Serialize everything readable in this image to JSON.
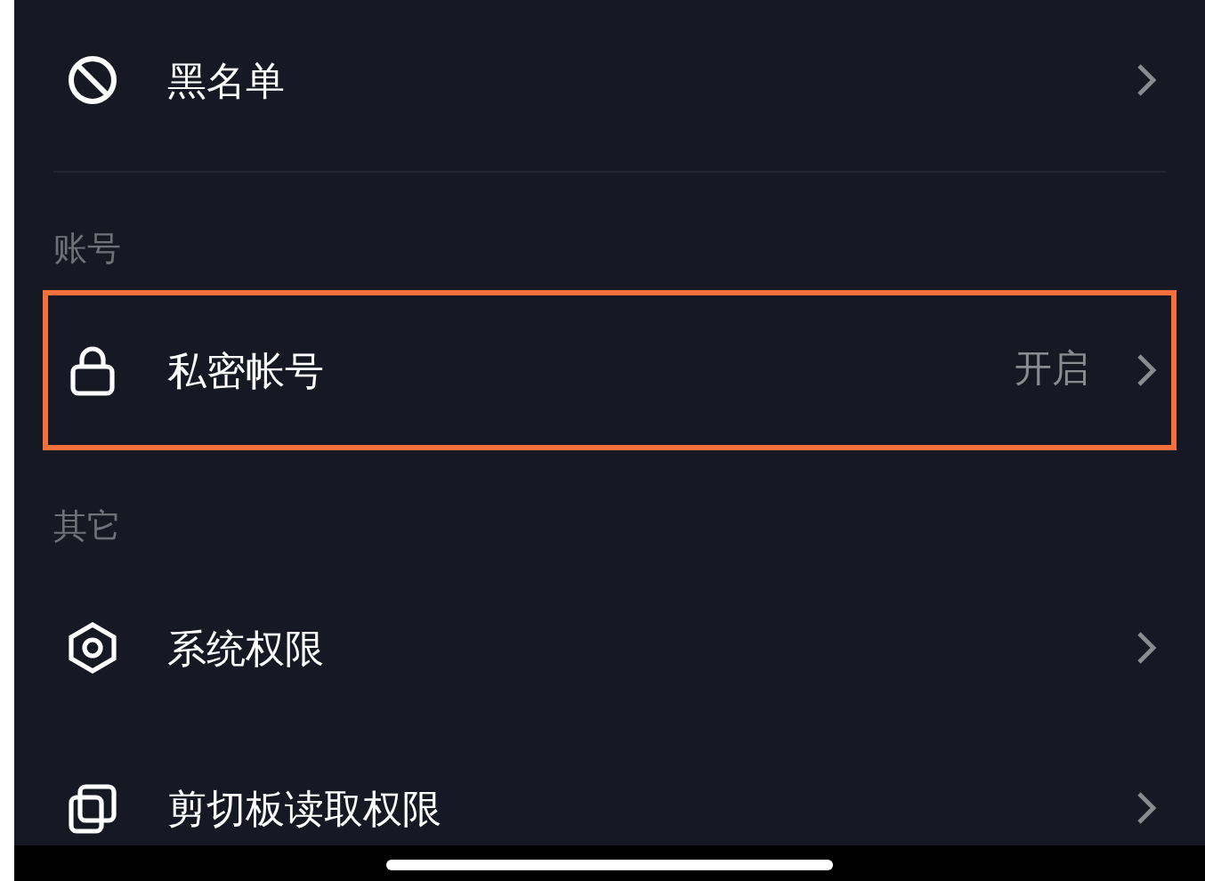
{
  "sections": [
    {
      "items": [
        {
          "label": "黑名单",
          "highlighted": false
        }
      ]
    },
    {
      "title": "账号",
      "items": [
        {
          "label": "私密帐号",
          "value": "开启",
          "highlighted": true
        }
      ]
    },
    {
      "title": "其它",
      "items": [
        {
          "label": "系统权限",
          "highlighted": false
        },
        {
          "label": "剪切板读取权限",
          "highlighted": false
        }
      ]
    }
  ]
}
